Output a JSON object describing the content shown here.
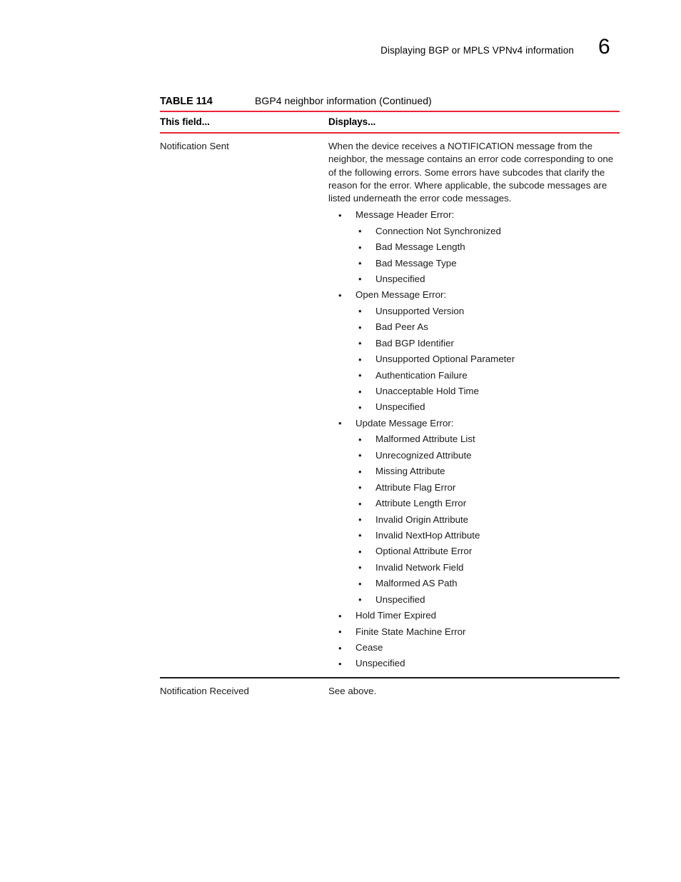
{
  "header": {
    "title": "Displaying BGP or MPLS VPNv4 information",
    "page_number": "6"
  },
  "table": {
    "label": "TABLE 114",
    "title": "BGP4 neighbor information  (Continued)",
    "rule_color": "#ea2433",
    "separator_color": "#1a1a1a",
    "columns": [
      "This field...",
      "Displays..."
    ],
    "rows": [
      {
        "field": "Notification Sent",
        "description": "When the device receives a NOTIFICATION message from the neighbor, the message contains an error code corresponding to one of the following errors. Some errors have subcodes that clarify the reason for the error. Where applicable, the subcode messages are listed underneath the error code messages.",
        "bullets": [
          {
            "label": "Message Header Error:",
            "children": [
              "Connection Not Synchronized",
              "Bad Message Length",
              "Bad Message Type",
              "Unspecified"
            ]
          },
          {
            "label": "Open Message Error:",
            "children": [
              "Unsupported Version",
              "Bad Peer As",
              "Bad BGP Identifier",
              "Unsupported Optional Parameter",
              "Authentication Failure",
              "Unacceptable Hold Time",
              "Unspecified"
            ]
          },
          {
            "label": "Update Message Error:",
            "children": [
              "Malformed Attribute List",
              "Unrecognized Attribute",
              "Missing Attribute",
              "Attribute Flag Error",
              "Attribute Length Error",
              "Invalid Origin Attribute",
              "Invalid NextHop Attribute",
              "Optional Attribute Error",
              "Invalid Network Field",
              "Malformed AS Path",
              "Unspecified"
            ]
          },
          {
            "label": "Hold Timer Expired",
            "children": []
          },
          {
            "label": "Finite State Machine Error",
            "children": []
          },
          {
            "label": "Cease",
            "children": []
          },
          {
            "label": "Unspecified",
            "children": []
          }
        ]
      },
      {
        "field": "Notification Received",
        "description": "See above.",
        "bullets": []
      }
    ],
    "bullet_glyph": "•"
  }
}
